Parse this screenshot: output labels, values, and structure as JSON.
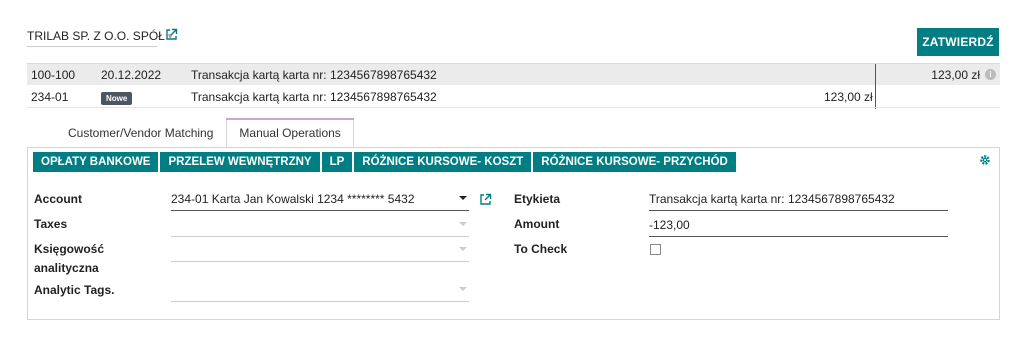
{
  "header": {
    "company": "TRILAB SP. Z O.O. SPÓŁ",
    "validate_label": "ZATWIERDŹ"
  },
  "statement_line": {
    "ref": "100-100",
    "date": "20.12.2022",
    "label": "Transakcja kartą karta nr: 1234567898765432",
    "amount": "123,00 zł"
  },
  "move_line": {
    "account": "234-01",
    "badge": "Nowe",
    "label": "Transakcja kartą karta nr: 1234567898765432",
    "amount": "123,00 zł"
  },
  "tabs": [
    {
      "label": "Customer/Vendor Matching",
      "active": false
    },
    {
      "label": "Manual Operations",
      "active": true
    }
  ],
  "models": [
    "OPŁATY BANKOWE",
    "PRZELEW WEWNĘTRZNY",
    "LP",
    "RÓŻNICE KURSOWE- KOSZT",
    "RÓŻNICE KURSOWE- PRZYCHÓD"
  ],
  "form": {
    "account_label": "Account",
    "account_value": "234-01 Karta Jan Kowalski 1234 ******** 5432",
    "taxes_label": "Taxes",
    "analytic_label_1": "Księgowość",
    "analytic_label_2": "analityczna",
    "tags_label": "Analytic Tags.",
    "etykieta_label": "Etykieta",
    "etykieta_value": "Transakcja kartą karta nr: 1234567898765432",
    "amount_label": "Amount",
    "amount_value": "-123,00",
    "to_check_label": "To Check"
  },
  "colors": {
    "primary": "#017e84",
    "badge": "#4c5761"
  }
}
